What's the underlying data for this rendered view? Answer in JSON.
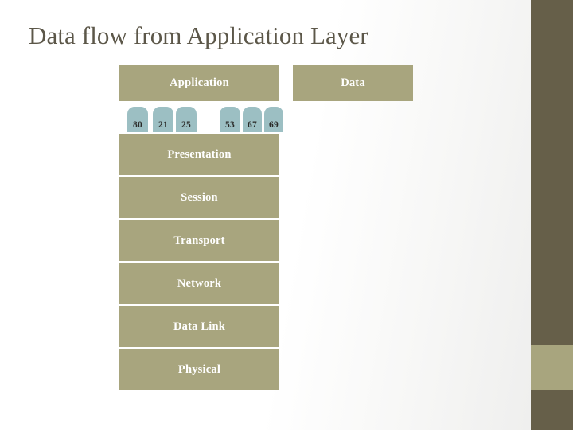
{
  "slide": {
    "title": "Data flow from Application Layer",
    "background_color": "#ffffff",
    "accent_color": "#a8a57e",
    "dark_accent_color": "#665f49",
    "port_color": "#9cbfc3",
    "title_color": "#5c5749"
  },
  "stack": {
    "name": "osi-layer-stack",
    "layers": [
      {
        "label": "Application"
      },
      {
        "label": "Presentation"
      },
      {
        "label": "Session"
      },
      {
        "label": "Transport"
      },
      {
        "label": "Network"
      },
      {
        "label": "Data Link"
      },
      {
        "label": "Physical"
      }
    ]
  },
  "ports": {
    "label": "port-numbers",
    "values": [
      "80",
      "21",
      "25",
      "53",
      "67",
      "69"
    ]
  },
  "data_box": {
    "label": "Data"
  },
  "decoration": {
    "right_bar_top": "",
    "right_bar_accent": "",
    "right_bar_bottom": ""
  }
}
